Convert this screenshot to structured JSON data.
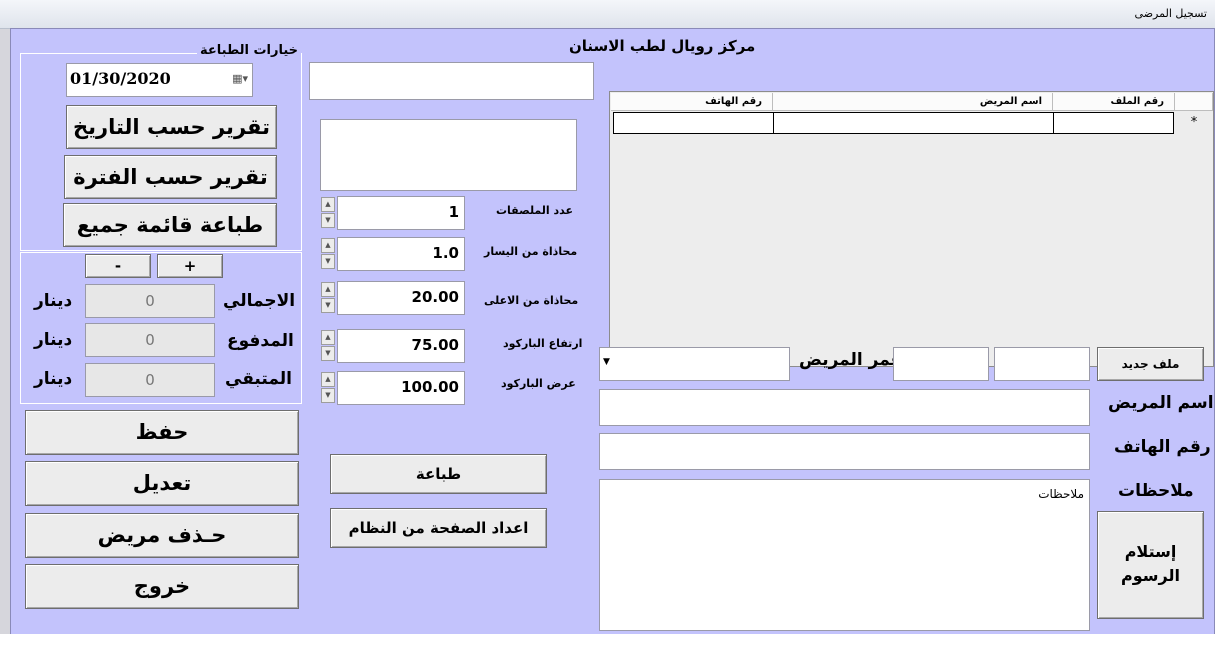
{
  "window": {
    "title": "تسجيل المرضى"
  },
  "header": {
    "clinic_name": "مركز رويال لطب الاسنان"
  },
  "print_options": {
    "legend": "خيارات الطباعة",
    "date_value": "01/30/2020",
    "report_by_date": "تقرير حسب التاريخ",
    "report_by_period": "تقرير حسب الفترة",
    "print_all_list": "طباعة قائمة جميع"
  },
  "totals": {
    "minus": "-",
    "plus": "+",
    "total_label": "الاجمالي",
    "paid_label": "المدفوع",
    "remaining_label": "المتبقي",
    "total_value": "0",
    "paid_value": "0",
    "remaining_value": "0",
    "currency": "دينار"
  },
  "actions": {
    "save": "حفظ",
    "edit": "تعديل",
    "delete_patient": "حـذف مريض",
    "exit": "خروج"
  },
  "barcode": {
    "labels_count_label": "عدد الملصقات",
    "labels_count": "1",
    "left_align_label": "محاذاة من اليسار",
    "left_align": "1.0",
    "top_align_label": "محاذاة من الاعلى",
    "top_align": "20.00",
    "height_label": "ارتفاع الباركود",
    "height": "75.00",
    "width_label": "عرض الباركود",
    "width": "100.00",
    "print_button": "طباعة",
    "page_setup_button": "اعداد الصفحة من النظام"
  },
  "grid": {
    "columns": [
      "رقم الملف",
      "اسم المريض",
      "رقم الهاتف"
    ],
    "new_row_marker": "*"
  },
  "patient_form": {
    "new_file_button": "ملف جديد",
    "age_label": "عمر المريض",
    "name_label": "اسم المريض",
    "phone_label": "رقم الهاتف",
    "notes_label": "ملاحظات",
    "notes_value": "ملاحظات",
    "receive_fees_line1": "إستلام",
    "receive_fees_line2": "الرسوم"
  },
  "colors": {
    "client_bg": "#c3c3fc",
    "button_bg": "#ececec"
  }
}
